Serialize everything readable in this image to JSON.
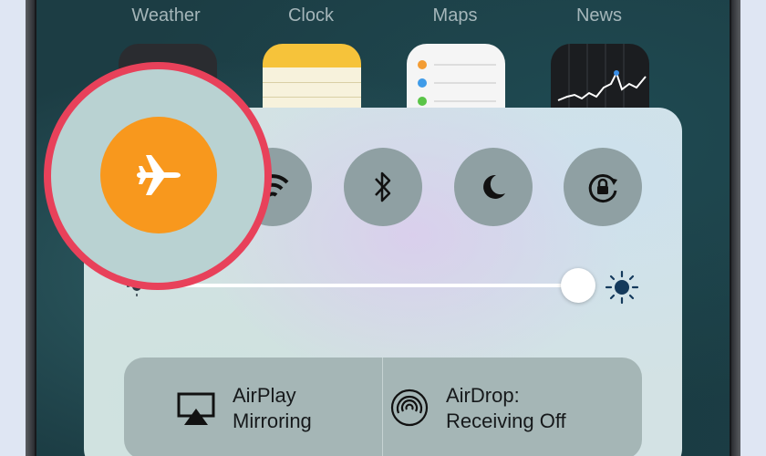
{
  "home_screen": {
    "app_labels": [
      "Weather",
      "Clock",
      "Maps",
      "News"
    ]
  },
  "control_center": {
    "toggles": [
      {
        "name": "airplane-mode",
        "icon": "airplane-icon",
        "active": true,
        "color": "#f8981d"
      },
      {
        "name": "wifi",
        "icon": "wifi-icon",
        "active": false
      },
      {
        "name": "bluetooth",
        "icon": "bluetooth-icon",
        "active": false
      },
      {
        "name": "do-not-disturb",
        "icon": "moon-icon",
        "active": false
      },
      {
        "name": "rotation-lock",
        "icon": "rotation-lock-icon",
        "active": false
      }
    ],
    "brightness": {
      "level": 1.0,
      "min_icon": "sun-small-icon",
      "max_icon": "sun-large-icon"
    },
    "airplay": {
      "label_line1": "AirPlay",
      "label_line2": "Mirroring",
      "icon": "airplay-icon"
    },
    "airdrop": {
      "label_line1": "AirDrop:",
      "label_line2": "Receiving Off",
      "icon": "airdrop-icon"
    }
  },
  "highlight": {
    "color": "#e8415a",
    "target": "airplane-mode"
  }
}
